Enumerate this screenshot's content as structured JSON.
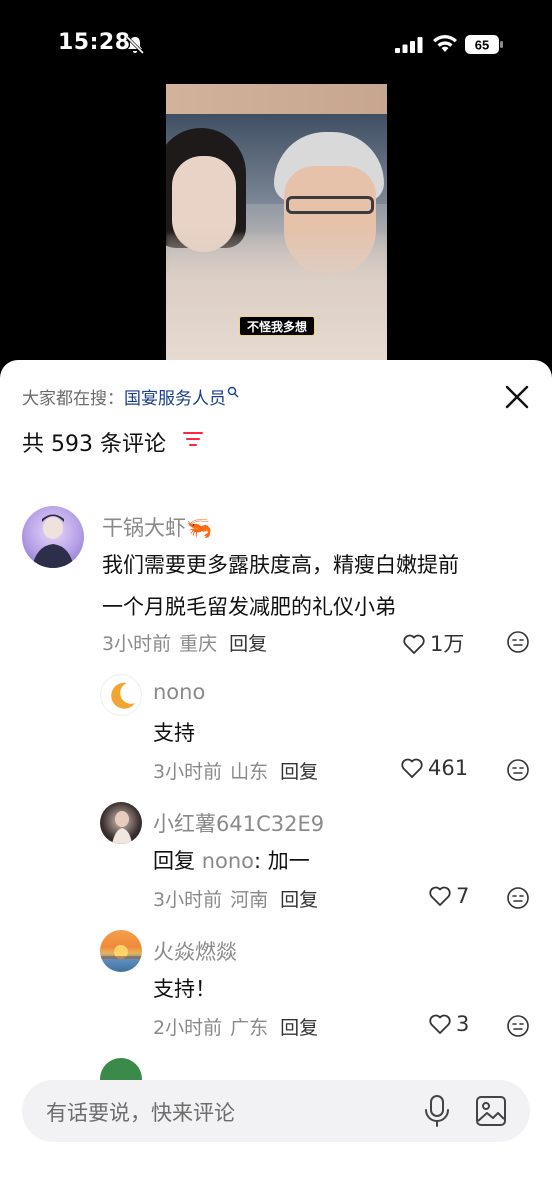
{
  "status_bar": {
    "time": "15:28",
    "battery": "65"
  },
  "video": {
    "subtitle": "不怪我多想"
  },
  "sheet": {
    "search_prefix": "大家都在搜：",
    "search_term": "国宴服务人员",
    "count_text": "共 593 条评论",
    "icons": [
      "close-icon",
      "sort-icon",
      "search-icon"
    ]
  },
  "comments": [
    {
      "author": "干锅大虾",
      "author_emoji": "🦐",
      "lines": [
        "我们需要更多露肤度高，精瘦白嫩提前",
        "一个月脱毛留发减肥的礼仪小弟"
      ],
      "time": "3小时前",
      "location": "重庆",
      "reply_label": "回复",
      "likes": "1万"
    },
    {
      "author": "nono",
      "text": "支持",
      "time": "3小时前",
      "location": "山东",
      "reply_label": "回复",
      "likes": "461"
    },
    {
      "author": "小红薯641C32E9",
      "reply_prefix": "回复 ",
      "reply_to": "nono",
      "reply_suffix": ": 加一",
      "time": "3小时前",
      "location": "河南",
      "reply_label": "回复",
      "likes": "7"
    },
    {
      "author": "火焱燃燚",
      "text": "支持！",
      "time": "2小时前",
      "location": "广东",
      "reply_label": "回复",
      "likes": "3"
    }
  ],
  "input": {
    "placeholder": "有话要说，快来评论"
  },
  "colors": {
    "accent_red": "#ff2442",
    "link_blue": "#1c3f8f",
    "muted": "#8a8a8a"
  }
}
